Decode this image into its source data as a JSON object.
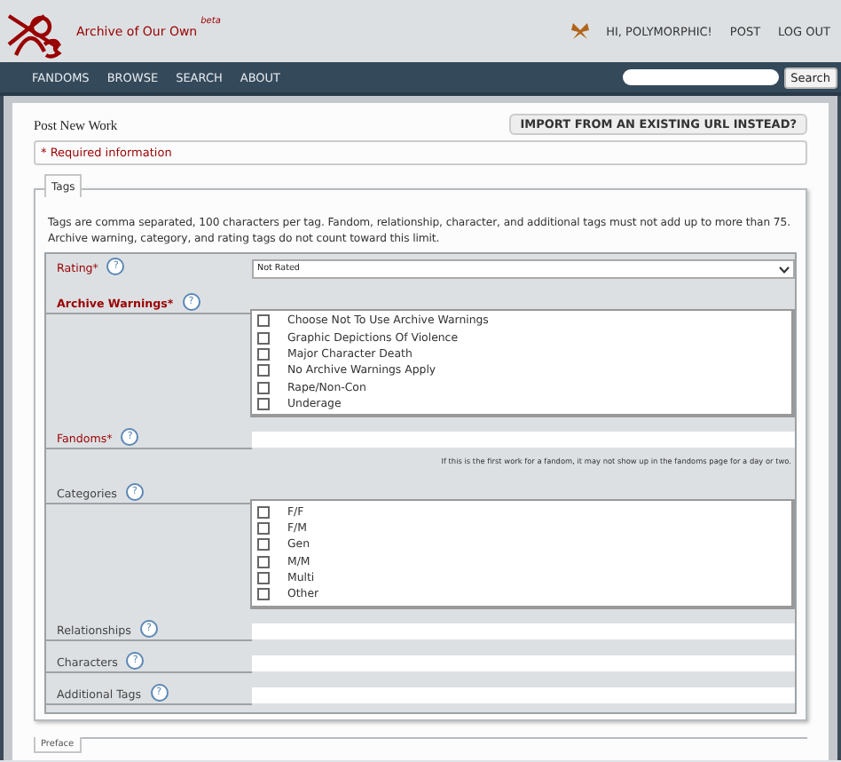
{
  "header": {
    "logo_text": "Archive of Our Own",
    "logo_sup": "beta",
    "user_links": [
      "HI, POLYMORPHIC!",
      "POST",
      "LOG OUT"
    ]
  },
  "nav": {
    "items": [
      "FANDOMS",
      "BROWSE",
      "SEARCH",
      "ABOUT"
    ],
    "search": {
      "button": "Search"
    }
  },
  "page": {
    "title": "Post New Work",
    "import_button": "IMPORT FROM AN EXISTING URL INSTEAD?",
    "required_note": "* Required information"
  },
  "tags": {
    "legend": "Tags",
    "intro": "Tags are comma separated, 100 characters per tag. Fandom, relationship, character, and additional tags must not add up to more than 75. Archive warning, category, and rating tags do not count toward this limit.",
    "fields": [
      {
        "kind": "select",
        "label": "Rating*",
        "required": true,
        "help": "?",
        "value": "Not Rated"
      },
      {
        "kind": "checklist",
        "label": "Archive Warnings*",
        "required": true,
        "help": "?",
        "options": [
          {
            "label": "Choose Not To Use Archive Warnings",
            "checked": false
          },
          {
            "label": "Graphic Depictions Of Violence",
            "checked": false
          },
          {
            "label": "Major Character Death",
            "checked": false
          },
          {
            "label": "No Archive Warnings Apply",
            "checked": false
          },
          {
            "label": "Rape/Non-Con",
            "checked": false
          },
          {
            "label": "Underage",
            "checked": false
          }
        ]
      },
      {
        "kind": "text",
        "label": "Fandoms*",
        "required": true,
        "help": "?",
        "note": "If this is the first work for a fandom, it may not show up in the fandoms page for a day or two."
      },
      {
        "kind": "checklist",
        "label": "Categories",
        "required": false,
        "help": "?",
        "options": [
          {
            "label": "F/F",
            "checked": false
          },
          {
            "label": "F/M",
            "checked": false
          },
          {
            "label": "Gen",
            "checked": false
          },
          {
            "label": "M/M",
            "checked": false
          },
          {
            "label": "Multi",
            "checked": false
          },
          {
            "label": "Other",
            "checked": false
          }
        ]
      },
      {
        "kind": "text",
        "label": "Relationships",
        "required": false,
        "help": "?"
      },
      {
        "kind": "text",
        "label": "Characters",
        "required": false,
        "help": "?"
      },
      {
        "kind": "text",
        "label": "Additional Tags",
        "required": false,
        "help": "?"
      }
    ]
  },
  "preface": {
    "legend": "Preface"
  }
}
